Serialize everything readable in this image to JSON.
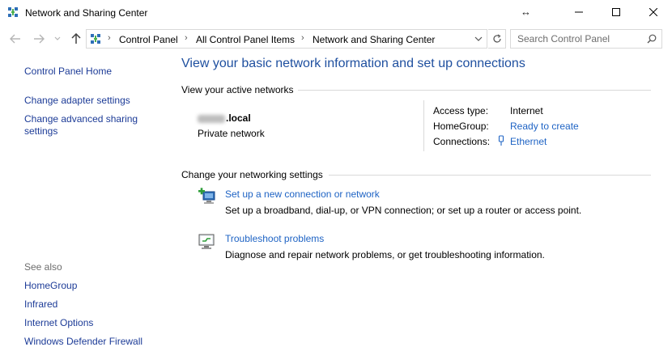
{
  "window": {
    "title": "Network and Sharing Center",
    "resize_glyph": "↔"
  },
  "nav": {
    "breadcrumbs": [
      "Control Panel",
      "All Control Panel Items",
      "Network and Sharing Center"
    ],
    "search_placeholder": "Search Control Panel"
  },
  "sidebar": {
    "home": "Control Panel Home",
    "links": [
      "Change adapter settings",
      "Change advanced sharing settings"
    ],
    "see_also_label": "See also",
    "see_also": [
      "HomeGroup",
      "Infrared",
      "Internet Options",
      "Windows Defender Firewall"
    ]
  },
  "main": {
    "title": "View your basic network information and set up connections",
    "active_networks_heading": "View your active networks",
    "network": {
      "name_suffix": ".local",
      "type": "Private network"
    },
    "details": {
      "access_type_label": "Access type:",
      "access_type_value": "Internet",
      "homegroup_label": "HomeGroup:",
      "homegroup_value": "Ready to create",
      "connections_label": "Connections:",
      "connections_value": "Ethernet"
    },
    "change_heading": "Change your networking settings",
    "tasks": [
      {
        "title": "Set up a new connection or network",
        "description": "Set up a broadband, dial-up, or VPN connection; or set up a router or access point.",
        "icon": "new-connection-icon"
      },
      {
        "title": "Troubleshoot problems",
        "description": "Diagnose and repair network problems, or get troubleshooting information.",
        "icon": "troubleshoot-icon"
      }
    ]
  },
  "colors": {
    "link": "#1e63c4",
    "title_blue": "#1e4f9f",
    "sidebar_link": "#1c3b97",
    "muted": "#6d6d6d",
    "rule": "#d9d9d9"
  }
}
